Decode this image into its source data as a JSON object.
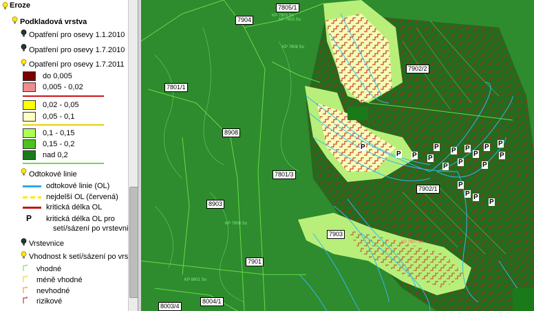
{
  "legend": {
    "root": "Eroze",
    "base_layer": "Podkladová vrstva",
    "sub_layers": [
      "Opatření pro osevy 1.1.2010",
      "Opatření pro osevy 1.7.2010",
      "Opatření pro osevy 1.7.2011"
    ],
    "classes": [
      {
        "label": "do 0,005",
        "color": "#7a0000"
      },
      {
        "label": "0,005 - 0,02",
        "color": "#f08c8c"
      },
      {
        "label": "0,02 - 0,05",
        "color": "#ffff00"
      },
      {
        "label": "0,05 - 0,1",
        "color": "#ffffc0"
      },
      {
        "label": "0,1 - 0,15",
        "color": "#aaff55"
      },
      {
        "label": "0,15 - 0,2",
        "color": "#4cc21c"
      },
      {
        "label": "nad 0,2",
        "color": "#1a7a1a"
      }
    ],
    "group_line_colors": [
      "#c81414",
      "#e8d000",
      "#66dd44"
    ],
    "runoff_layer": "Odtokové linie",
    "runoff_items": [
      {
        "label": "odtokové linie (OL)",
        "style": "solid-blue"
      },
      {
        "label": "nejdelší OL (červená)",
        "style": "dashed-yellow"
      },
      {
        "label": "kritická délka OL",
        "style": "solid-red"
      },
      {
        "label": "kritická délka OL pro",
        "label2": "setí/sázení po vrstevnicích",
        "style": "P-symbol"
      }
    ],
    "contours": "Vrstevnice",
    "suitability": "Vhodnost k setí/sázení po vrstevnicích",
    "suitability_items": [
      {
        "label": "vhodné",
        "color": "#66dd44"
      },
      {
        "label": "méně vhodné",
        "color": "#e8d000"
      },
      {
        "label": "nevhodné",
        "color": "#e89000"
      },
      {
        "label": "rizikové",
        "color": "#b01010"
      }
    ]
  },
  "map": {
    "parcels": [
      {
        "id": "7805/1"
      },
      {
        "id": "7904"
      },
      {
        "id": "7801/1"
      },
      {
        "id": "7902/2"
      },
      {
        "id": "8908"
      },
      {
        "id": "7801/3"
      },
      {
        "id": "7902/1"
      },
      {
        "id": "8903"
      },
      {
        "id": "7903"
      },
      {
        "id": "7901"
      },
      {
        "id": "8003/4"
      },
      {
        "id": "8004/1"
      }
    ],
    "kp_labels": [
      "KP 7903 So",
      "KP 7903 So",
      "KP 7906 So",
      "KP 7907 So",
      "KP 8901 So",
      "KP 7906 So"
    ],
    "p_symbol": "P"
  }
}
